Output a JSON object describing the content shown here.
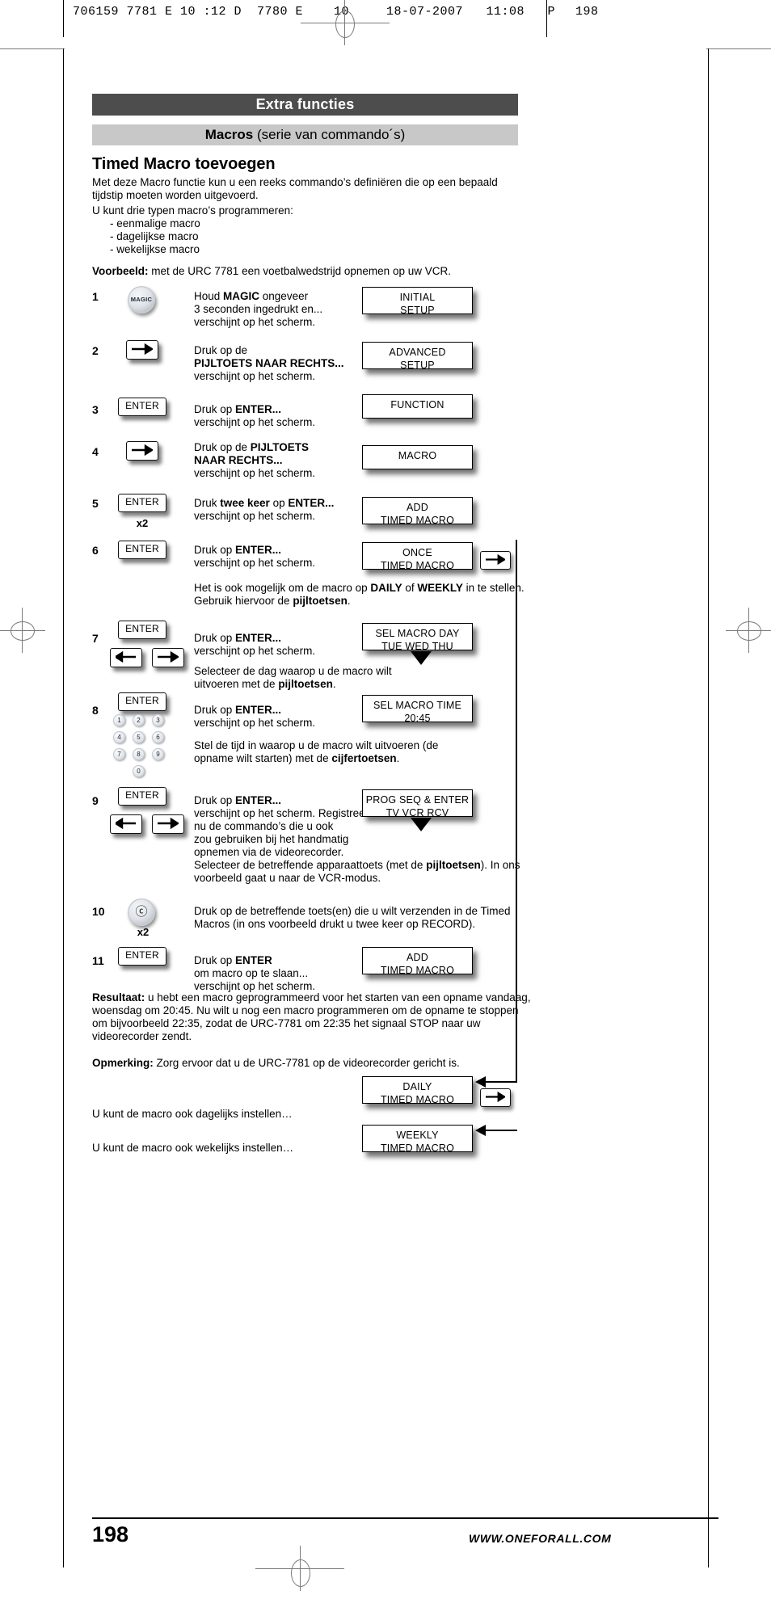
{
  "print_header": {
    "left": "706159 7781 E 10 :12 D",
    "middle": "7780 E    10",
    "date": "18-07-2007   11:08   P",
    "page": "198"
  },
  "section": {
    "title": "Extra functies",
    "subtitle_bold": "Macros",
    "subtitle_rest": " (serie van commando´s)",
    "heading": "Timed Macro toevoegen"
  },
  "intro": {
    "p1": "Met deze Macro functie kun u een reeks commando’s definiëren die op een bepaald tijdstip moeten worden uitgevoerd.",
    "p2": "U kunt drie typen macro’s programmeren:",
    "list": [
      "- eenmalige macro",
      "- dagelijkse macro",
      "- wekelijkse macro"
    ],
    "example_bold": "Voorbeeld:",
    "example_rest": " met de URC 7781 een voetbalwedstrijd opnemen op uw VCR."
  },
  "steps": [
    {
      "num": "1",
      "key": "MAGIC",
      "text_html": "Houd <b>MAGIC</b> ongeveer<br>3 seconden ingedrukt en...<br>verschijnt op het scherm.",
      "lcd": {
        "line1": "INITIAL",
        "line2": "SETUP"
      }
    },
    {
      "num": "2",
      "key": "arrow-right",
      "text_html": "Druk op de<br><b>PIJLTOETS NAAR RECHTS...</b><br>verschijnt op het scherm.",
      "lcd": {
        "line1": "ADVANCED",
        "line2": "SETUP"
      }
    },
    {
      "num": "3",
      "key": "ENTER",
      "text_html": "Druk op <b>ENTER...</b><br>verschijnt op het scherm.",
      "lcd": {
        "line1": "FUNCTION",
        "line2": ""
      }
    },
    {
      "num": "4",
      "key": "arrow-right",
      "text_html": "Druk op de <b>PIJLTOETS<br>NAAR RECHTS...</b><br>verschijnt op het scherm.",
      "lcd": {
        "line1": "MACRO",
        "line2": ""
      }
    },
    {
      "num": "5",
      "key": "ENTER",
      "multiplier": "x2",
      "text_html": "Druk <b>twee keer</b> op <b>ENTER...</b><br>verschijnt op het scherm.",
      "lcd": {
        "line1": "ADD",
        "line2": "TIMED MACRO"
      }
    },
    {
      "num": "6",
      "key": "ENTER",
      "text_html": "Druk op <b>ENTER...</b><br>verschijnt op het scherm.",
      "lcd": {
        "line1": "ONCE",
        "line2": "TIMED MACRO"
      }
    },
    {
      "num": "7",
      "key": "ENTER",
      "text_html": "Druk op <b>ENTER...</b><br>verschijnt op het scherm.",
      "lcd": {
        "line1": "SEL MACRO DAY",
        "line2": "TUE   WED   THU"
      }
    },
    {
      "num": "8",
      "key": "ENTER",
      "text_html": "Druk op <b>ENTER...</b><br>verschijnt op het scherm.",
      "lcd": {
        "line1": "SEL MACRO TIME",
        "line2": "20:45"
      }
    },
    {
      "num": "9",
      "key": "ENTER",
      "text_html": "Druk op <b>ENTER...</b><br>verschijnt op het scherm. Registreer<br>nu de commando’s die u ook<br>zou gebruiken bij het handmatig<br>opnemen via de videorecorder.",
      "lcd": {
        "line1": "PROG SEQ & ENTER",
        "line2": "TV    VCR    RCV"
      }
    },
    {
      "num": "10",
      "key": "RECORD",
      "multiplier": "x2",
      "text_html": "Druk op de betreffende toets(en) die u wilt verzenden in de Timed<br>Macros (in ons voorbeeld drukt u twee keer op RECORD).",
      "lcd": null
    },
    {
      "num": "11",
      "key": "ENTER",
      "text_html": "Druk op <b>ENTER</b><br>om macro op te slaan...<br>verschijnt op het scherm.",
      "lcd": {
        "line1": "ADD",
        "line2": "TIMED MACRO"
      }
    }
  ],
  "notes": {
    "after_step6": "Het is ook mogelijk om de macro op <b>DAILY</b> of <b>WEEKLY</b> in te stellen. Gebruik hiervoor de <b>pijltoetsen</b>.",
    "after_step7": "Selecteer de dag waarop u de macro wilt uitvoeren met de <b>pijltoetsen</b>.",
    "after_step8": "Stel de tijd in waarop u de macro wilt uitvoeren (de opname wilt starten) met de <b>cijfertoetsen</b>.",
    "after_step9": "Selecteer de betreffende apparaattoets (met de <b>pijltoetsen</b>). In ons voorbeeld gaat u naar de VCR-modus."
  },
  "result": {
    "label": "Resultaat:",
    "text": " u hebt een macro geprogrammeerd voor het starten van een opname vandaag, woensdag om 20:45. Nu wilt u nog een macro programmeren om de opname te stoppen om bijvoorbeeld 22:35, zodat de URC-7781 om 22:35 het signaal STOP naar uw videorecorder zendt."
  },
  "remark": {
    "label": "Opmerking:",
    "text": " Zorg ervoor dat u de URC-7781 op de videorecorder gericht is."
  },
  "bottom": {
    "daily_text": "U kunt de macro ook dagelijks instellen…",
    "weekly_text": "U kunt de macro ook wekelijks instellen…",
    "daily_lcd": {
      "line1": "DAILY",
      "line2": "TIMED MACRO"
    },
    "weekly_lcd": {
      "line1": "WEEKLY",
      "line2": "TIMED MACRO"
    }
  },
  "numpad": {
    "keys": [
      "1",
      "2",
      "3",
      "4",
      "5",
      "6",
      "7",
      "8",
      "9",
      "0"
    ]
  },
  "footer": {
    "page_number": "198",
    "url": "WWW.ONEFORALL.COM"
  },
  "colors": {
    "title_bar": "#4d4d4d",
    "sub_bar": "#c8c8c8",
    "text": "#000000"
  }
}
